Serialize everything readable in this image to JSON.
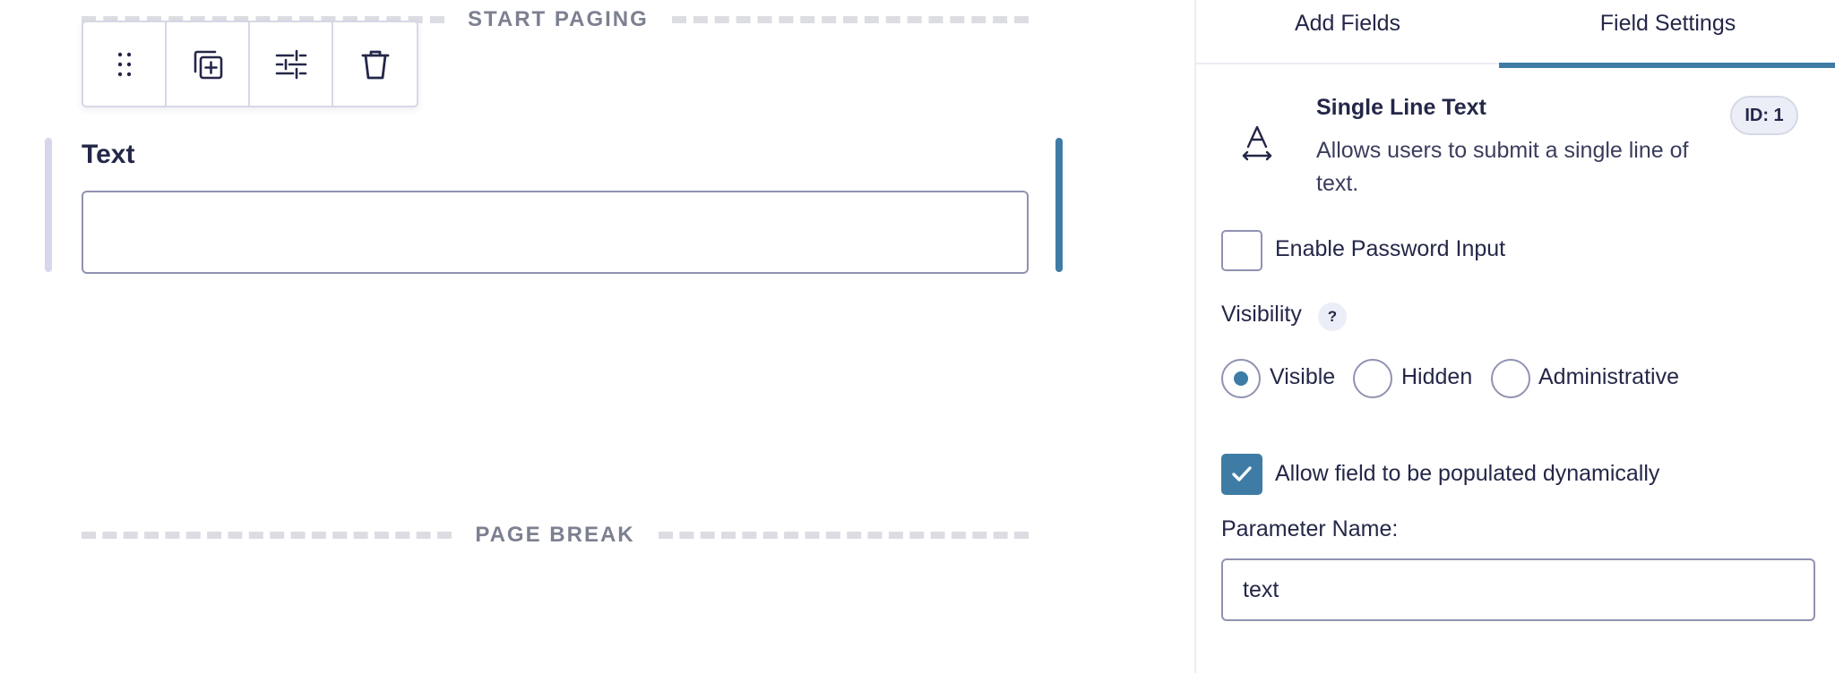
{
  "canvas": {
    "start_paging_label": "START PAGING",
    "page_break_label": "PAGE BREAK",
    "toolbar": {
      "drag_icon": "drag-handle-icon",
      "duplicate_icon": "duplicate-icon",
      "settings_icon": "sliders-icon",
      "delete_icon": "trash-icon"
    },
    "field": {
      "label": "Text",
      "value": ""
    }
  },
  "sidebar": {
    "tabs": [
      {
        "label": "Add Fields",
        "active": false
      },
      {
        "label": "Field Settings",
        "active": true
      }
    ],
    "field_type": {
      "icon": "text-field-icon",
      "title": "Single Line Text",
      "description": "Allows users to submit a single line of text.",
      "id_badge": "ID: 1"
    },
    "password": {
      "label": "Enable Password Input",
      "checked": false
    },
    "visibility": {
      "label": "Visibility",
      "help": "?",
      "options": [
        {
          "label": "Visible",
          "selected": true
        },
        {
          "label": "Hidden",
          "selected": false
        },
        {
          "label": "Administrative",
          "selected": false
        }
      ]
    },
    "dynamic": {
      "label": "Allow field to be populated dynamically",
      "checked": true
    },
    "parameter": {
      "label": "Parameter Name:",
      "value": "text"
    }
  },
  "colors": {
    "accent": "#3e7ca6",
    "text": "#242748",
    "border": "#9092b2",
    "muted": "#7c8090",
    "divider": "#dcdde3"
  }
}
